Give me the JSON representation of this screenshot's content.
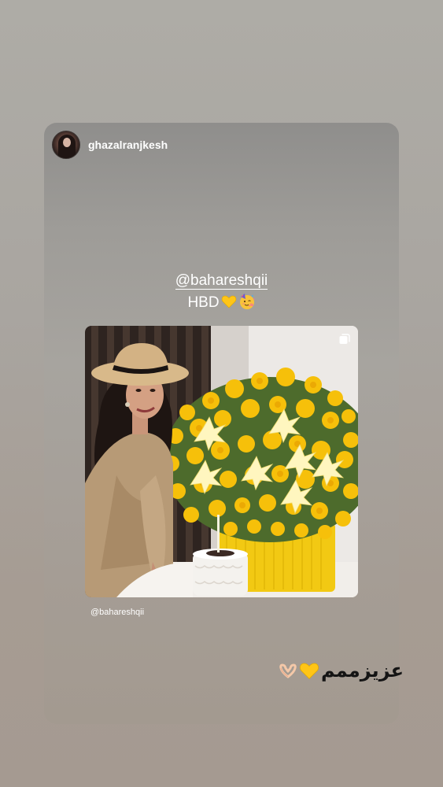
{
  "story": {
    "author": {
      "username": "ghazalranjkesh",
      "avatar_icon": "profile-avatar"
    },
    "mention_sticker": {
      "handle": "@bahareshqii"
    },
    "caption": {
      "text": "HBD",
      "emojis": [
        "yellow-heart-icon",
        "partying-face-icon"
      ]
    },
    "shared_post": {
      "author_handle": "@bahareshqii",
      "carousel_icon": "carousel-icon",
      "image_description_icon": "photo-woman-hat-yellow-flowers-cake"
    },
    "footer_text": {
      "text": "عزیزممم",
      "emojis": [
        "yellow-heart-icon",
        "heart-hands-icon"
      ]
    }
  },
  "colors": {
    "background_top": "#aeaca6",
    "background_bottom": "#a59a91",
    "text": "#ffffff",
    "caption_dark": "#141414",
    "accent_yellow": "#f2c200"
  }
}
